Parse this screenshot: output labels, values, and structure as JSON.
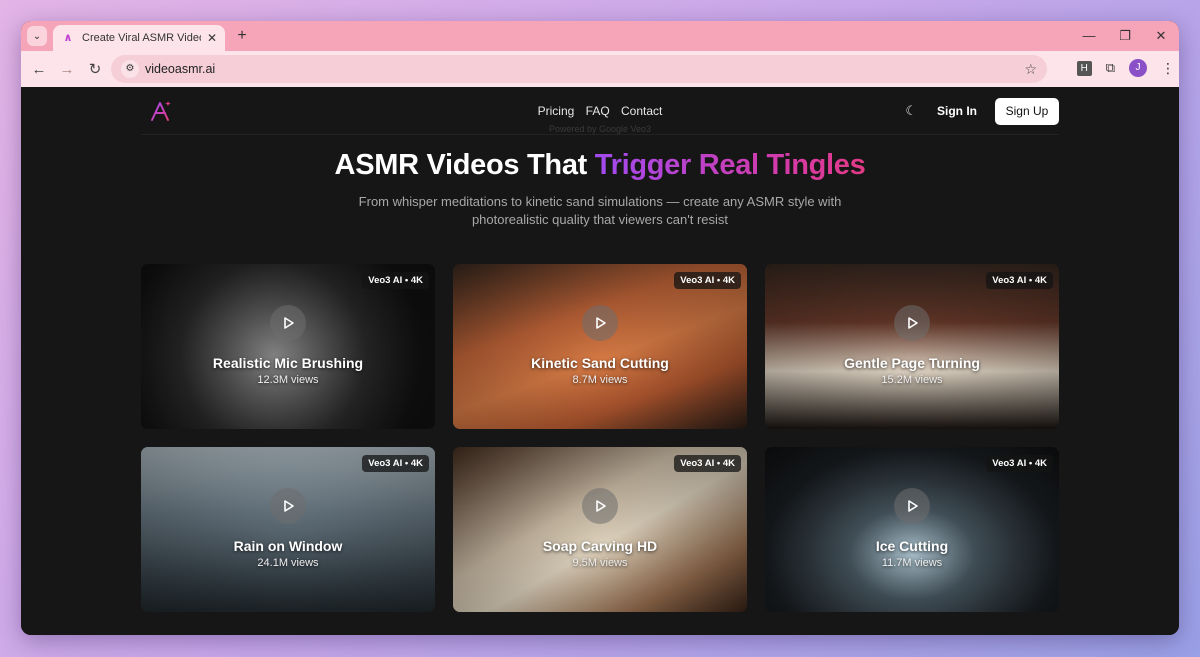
{
  "browser": {
    "tab_title": "Create Viral ASMR Videos with G",
    "url": "videoasmr.ai",
    "profile_initial": "J",
    "extension_letter": "H"
  },
  "header": {
    "nav": [
      "Pricing",
      "FAQ",
      "Contact"
    ],
    "powered_by": "Powered by Google Veo3",
    "sign_in": "Sign In",
    "sign_up": "Sign Up"
  },
  "hero": {
    "title_plain": "ASMR Videos That ",
    "title_gradient": "Trigger Real Tingles",
    "subtitle": "From whisper meditations to kinetic sand simulations — create any ASMR style with photorealistic quality that viewers can't resist"
  },
  "cards": [
    {
      "title": "Realistic Mic Brushing",
      "views": "12.3M views",
      "badge": "Veo3 AI • 4K"
    },
    {
      "title": "Kinetic Sand Cutting",
      "views": "8.7M views",
      "badge": "Veo3 AI • 4K"
    },
    {
      "title": "Gentle Page Turning",
      "views": "15.2M views",
      "badge": "Veo3 AI • 4K"
    },
    {
      "title": "Rain on Window",
      "views": "24.1M views",
      "badge": "Veo3 AI • 4K"
    },
    {
      "title": "Soap Carving HD",
      "views": "9.5M views",
      "badge": "Veo3 AI • 4K"
    },
    {
      "title": "Ice Cutting",
      "views": "11.7M views",
      "badge": "Veo3 AI • 4K"
    }
  ],
  "colors": {
    "gradient_start": "#a24bf0",
    "gradient_end": "#e23a86",
    "tabstrip": "#f6a4b8"
  }
}
